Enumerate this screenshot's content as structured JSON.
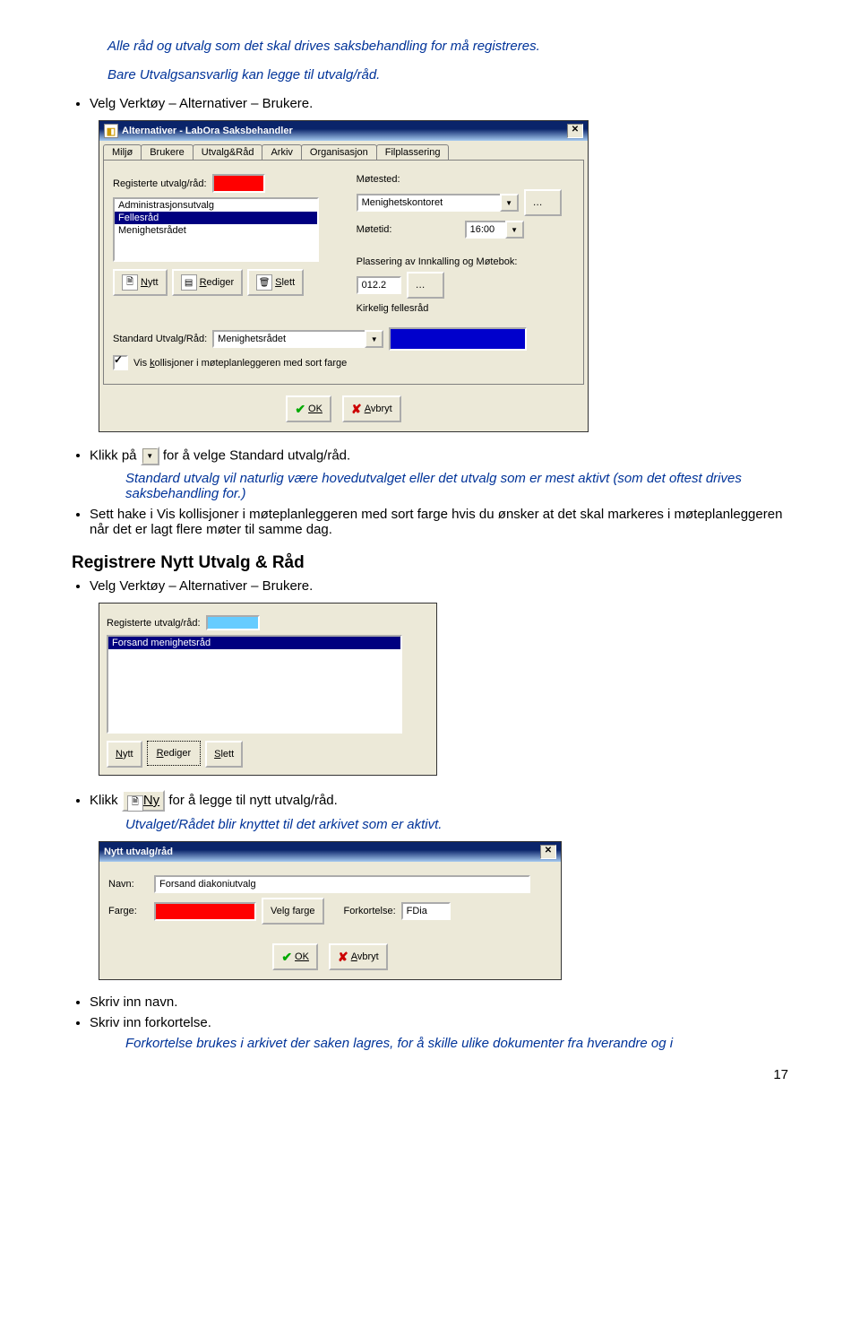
{
  "intro": {
    "line1": "Alle råd og utvalg som det skal drives saksbehandling for må registreres.",
    "line2": "Bare Utvalgsansvarlig kan legge til utvalg/råd."
  },
  "bullet_velg1": "Velg Verktøy – Alternativer – Brukere.",
  "dlg1": {
    "title": "Alternativer - LabOra Saksbehandler",
    "tabs": [
      "Miljø",
      "Brukere",
      "Utvalg&Råd",
      "Arkiv",
      "Organisasjon",
      "Filplassering"
    ],
    "reg_label": "Registerte utvalg/råd:",
    "list": [
      "Administrasjonsutvalg",
      "Fellesråd",
      "Menighetsrådet"
    ],
    "selected": "Fellesråd",
    "motested_lbl": "Møtested:",
    "motested_val": "Menighetskontoret",
    "motetid_lbl": "Møtetid:",
    "motetid_val": "16:00",
    "plass_lbl": "Plassering av Innkalling og Møtebok:",
    "plass_val": "012.2",
    "plass_txt": "Kirkelig fellesråd",
    "btn_nytt": "Nytt",
    "btn_rediger": "Rediger",
    "btn_slett": "Slett",
    "std_lbl": "Standard Utvalg/Råd:",
    "std_val": "Menighetsrådet",
    "vis_koll": "Vis kollisjoner i møteplanleggeren med sort farge",
    "ok": "OK",
    "avbryt": "Avbryt"
  },
  "bullet_klikk1_pre": "Klikk på",
  "bullet_klikk1_post": "for å velge Standard utvalg/råd.",
  "italic_std": "Standard utvalg vil naturlig være hovedutvalget eller det utvalg som er mest aktivt (som det oftest drives saksbehandling for.)",
  "bullet_sett_hake": "Sett hake i Vis kollisjoner i møteplanleggeren med sort farge hvis du ønsker at det skal markeres i møteplanleggeren når det er lagt flere møter til samme dag.",
  "heading_reg": "Registrere Nytt Utvalg & Råd",
  "bullet_velg2": "Velg Verktøy – Alternativer – Brukere.",
  "dlg2": {
    "reg_label": "Registerte utvalg/råd:",
    "list": [
      "Forsand menighetsråd"
    ],
    "btn_nytt": "Nytt",
    "btn_rediger": "Rediger",
    "btn_slett": "Slett"
  },
  "bullet_klikk2_pre": "Klikk",
  "bullet_klikk2_mid": "Ny",
  "bullet_klikk2_post": "for å legge til nytt utvalg/råd.",
  "italic_utvalg": "Utvalget/Rådet blir knyttet til det arkivet som er aktivt.",
  "dlg3": {
    "title": "Nytt utvalg/råd",
    "navn_lbl": "Navn:",
    "navn_val": "Forsand diakoniutvalg",
    "farge_lbl": "Farge:",
    "velgfarge": "Velg farge",
    "fork_lbl": "Forkortelse:",
    "fork_val": "FDia",
    "ok": "OK",
    "avbryt": "Avbryt"
  },
  "bullet_skriv_navn": "Skriv inn navn.",
  "bullet_skriv_fork": "Skriv inn forkortelse.",
  "italic_fork": "Forkortelse brukes i arkivet der saken lagres, for å skille ulike dokumenter fra hverandre og i",
  "page_number": "17"
}
